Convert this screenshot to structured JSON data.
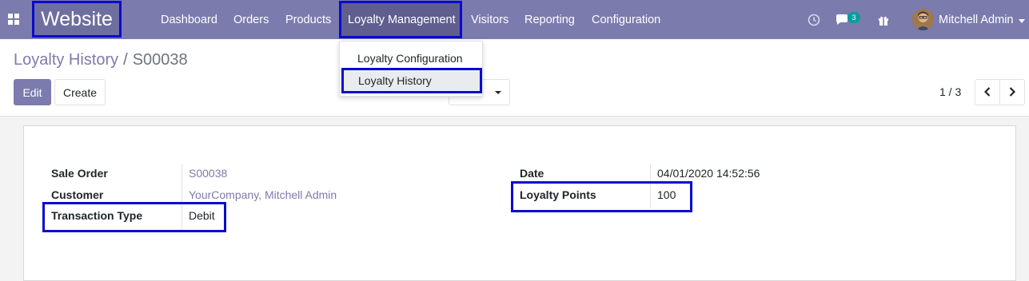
{
  "navbar": {
    "brand": "Website",
    "menu": [
      "Dashboard",
      "Orders",
      "Products",
      "Loyalty Management",
      "Visitors",
      "Reporting",
      "Configuration"
    ],
    "messages_count": "3",
    "user_name": "Mitchell Admin",
    "color": "#7c7bad"
  },
  "dropdown": {
    "items": [
      "Loyalty Configuration",
      "Loyalty History"
    ]
  },
  "breadcrumb": {
    "parent": "Loyalty History",
    "separator": "/",
    "current": "S00038"
  },
  "buttons": {
    "edit": "Edit",
    "create": "Create"
  },
  "pager": {
    "value": "1 / 3"
  },
  "form": {
    "left": [
      {
        "label": "Sale Order",
        "value": "S00038"
      },
      {
        "label": "Customer",
        "value": "YourCompany, Mitchell Admin"
      },
      {
        "label": "Transaction Type",
        "value": "Debit"
      }
    ],
    "right": [
      {
        "label": "Date",
        "value": "04/01/2020 14:52:56"
      },
      {
        "label": "Loyalty Points",
        "value": "100"
      }
    ]
  },
  "colors": {
    "highlight": "#0a0ad0",
    "primary": "#7c7bad",
    "badge": "#00a09d"
  }
}
